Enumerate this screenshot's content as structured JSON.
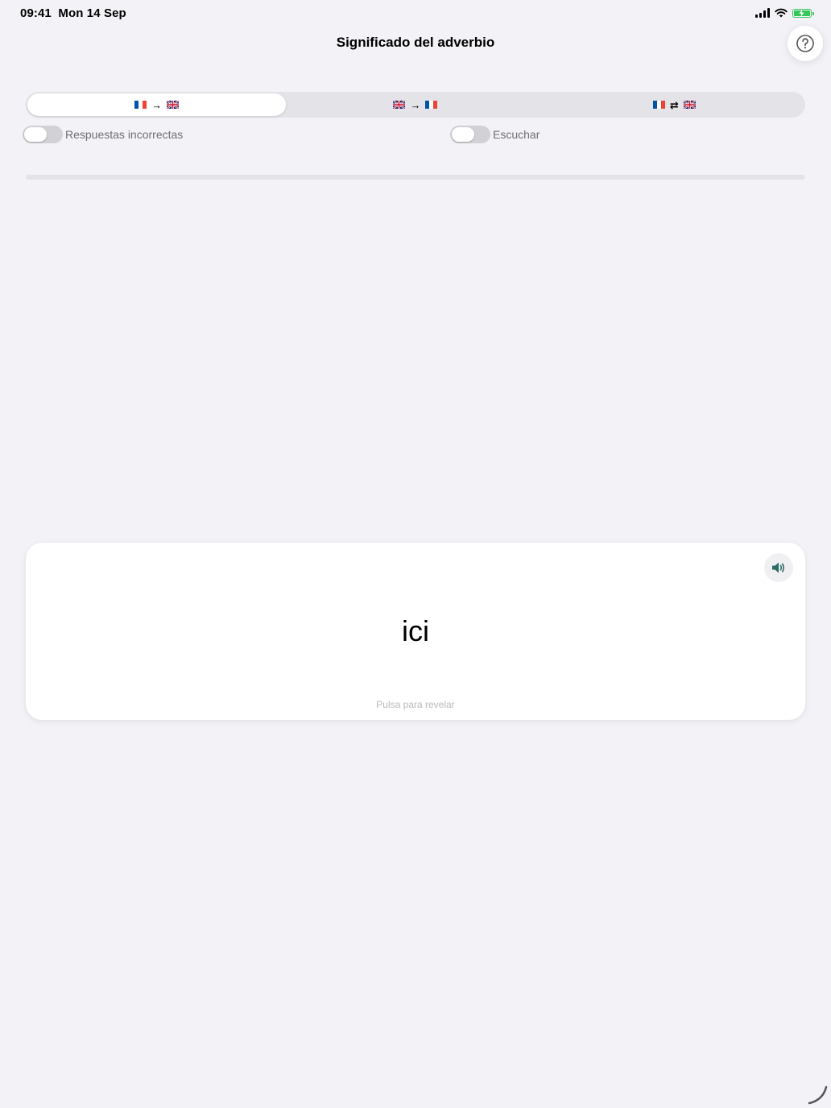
{
  "status_bar": {
    "time": "09:41",
    "date": "Mon 14 Sep",
    "battery_color": "#34c759"
  },
  "nav": {
    "title": "Significado del adverbio",
    "help_icon": "question-circle-icon"
  },
  "direction_tabs": [
    {
      "from": "fr-flag-icon",
      "connector": "→",
      "to": "gb-flag-icon",
      "active": true
    },
    {
      "from": "gb-flag-icon",
      "connector": "→",
      "to": "fr-flag-icon",
      "active": false
    },
    {
      "from": "fr-flag-icon",
      "connector": "⇄",
      "to": "gb-flag-icon",
      "active": false
    }
  ],
  "toggles": {
    "wrong_answers": {
      "label": "Respuestas incorrectas",
      "on": false
    },
    "listen": {
      "label": "Escuchar",
      "on": false
    }
  },
  "progress": {
    "value": 0
  },
  "card": {
    "word": "ici",
    "hint": "Pulsa para revelar",
    "speaker_icon": "speaker-icon",
    "accent_color": "#34a29a"
  }
}
